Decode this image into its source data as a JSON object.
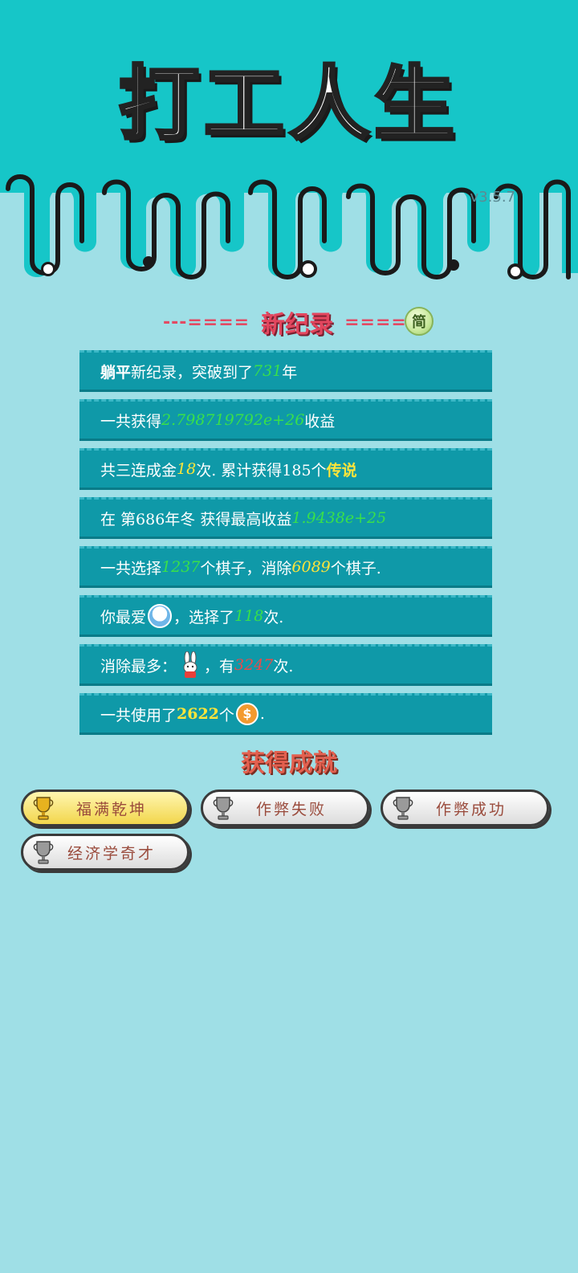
{
  "app": {
    "title": "打工人生",
    "version": "v3.5.7"
  },
  "record": {
    "title": "新纪录",
    "left_deco": "---====",
    "right_deco": "====-",
    "simplified_badge": "简"
  },
  "stats": {
    "row1": {
      "bold": "躺平",
      "text1": "新纪录，突破到了",
      "years": "731",
      "text2": "年"
    },
    "row2": {
      "text1": "一共获得",
      "value": "2.798719792e+26",
      "text2": "收益"
    },
    "row3": {
      "text1": "共三连成金",
      "count": "18",
      "text2": "次. 累计获得185个",
      "legend": "传说"
    },
    "row4": {
      "text1": "在 第686年冬 获得最高收益",
      "value": "1.9438e+25"
    },
    "row5": {
      "text1": "一共选择",
      "chosen": "1237",
      "text2": "个棋子，消除",
      "removed": "6089",
      "text3": "个棋子."
    },
    "row6": {
      "text1": "你最爱",
      "text2": "，选择了",
      "times": "118",
      "text3": "次."
    },
    "row7": {
      "text1": "消除最多：",
      "text2": "，有",
      "times": "3247",
      "text3": "次."
    },
    "row8": {
      "text1": "一共使用了",
      "amount": "2622",
      "text2": "个",
      "text3": "."
    }
  },
  "achievements": {
    "title": "获得成就",
    "items": [
      {
        "label": "福满乾坤",
        "tier": "gold"
      },
      {
        "label": "作弊失败",
        "tier": "silver"
      },
      {
        "label": "作弊成功",
        "tier": "silver"
      },
      {
        "label": "经济学奇才",
        "tier": "silver"
      }
    ]
  },
  "icons": {
    "favorite_piece": "rice-bowl-icon",
    "most_removed_piece": "rabbit-icon",
    "currency": "coin-icon",
    "achievement": "trophy-icon"
  },
  "colors": {
    "header_bg": "#16c6c8",
    "page_bg": "#9fdfe6",
    "row_bg": "#0f99a8",
    "highlight_green": "#39e04a",
    "highlight_yellow": "#ffe53a",
    "highlight_red": "#e84a4a"
  }
}
